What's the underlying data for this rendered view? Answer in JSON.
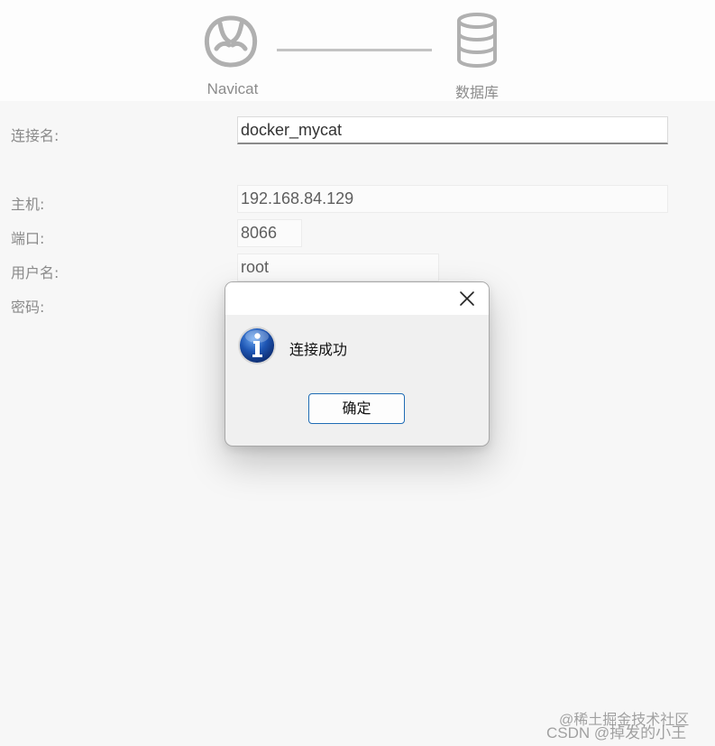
{
  "steps": {
    "source_label": "Navicat",
    "target_label": "数据库"
  },
  "form": {
    "connection_name_label": "连接名:",
    "connection_name_value": "docker_mycat",
    "host_label": "主机:",
    "host_value": "192.168.84.129",
    "port_label": "端口:",
    "port_value": "8066",
    "user_label": "用户名:",
    "user_value": "root",
    "password_label": "密码:"
  },
  "dialog": {
    "message": "连接成功",
    "ok_label": "确定",
    "icon": "info-icon",
    "close_icon": "close-icon"
  },
  "watermark": {
    "line1": "@稀土掘金技术社区",
    "line2": "CSDN @掉发的小王"
  },
  "colors": {
    "dialog_button_border": "#1f6cb5",
    "info_icon_blue": "#1b4fa8"
  }
}
